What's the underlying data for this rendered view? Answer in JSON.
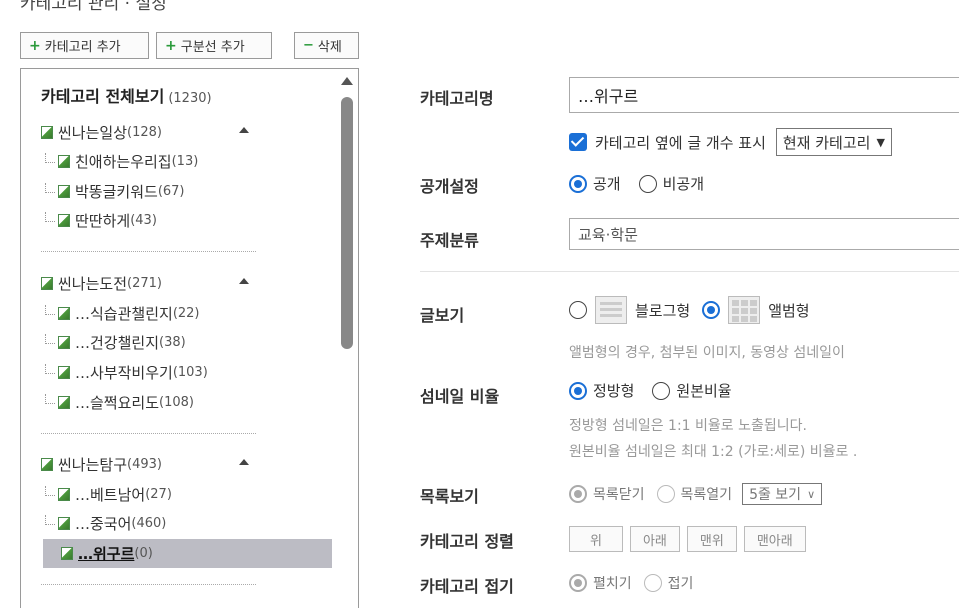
{
  "page": {
    "title": "카테고리 관리 · 설정"
  },
  "toolbar": {
    "add_category": "카테고리 추가",
    "add_separator": "구분선 추가",
    "delete": "삭제"
  },
  "tree": {
    "header": "카테고리 전체보기",
    "header_count": "(1230)",
    "groups": [
      {
        "label": "씬나는일상",
        "count": "(128)",
        "children": [
          {
            "label": "친애하는우리집",
            "count": "(13)"
          },
          {
            "label": "박똥글키워드",
            "count": "(67)"
          },
          {
            "label": "딴딴하게",
            "count": "(43)"
          }
        ]
      },
      {
        "label": "씬나는도전",
        "count": "(271)",
        "children": [
          {
            "label": "…식습관챌린지",
            "count": "(22)"
          },
          {
            "label": "…건강챌린지",
            "count": "(38)"
          },
          {
            "label": "…사부작비우기",
            "count": "(103)"
          },
          {
            "label": "…슬쩍요리도",
            "count": "(108)"
          }
        ]
      },
      {
        "label": "씬나는탐구",
        "count": "(493)",
        "children": [
          {
            "label": "…베트남어",
            "count": "(27)"
          },
          {
            "label": "…중국어",
            "count": "(460)"
          },
          {
            "label": "…위구르",
            "count": "(0)"
          }
        ]
      }
    ]
  },
  "form": {
    "name_label": "카테고리명",
    "name_value": "…위구르",
    "show_count_label": "카테고리 옆에 글 개수 표시",
    "show_count_select": "현재 카테고리",
    "visibility_label": "공개설정",
    "visibility_public": "공개",
    "visibility_private": "비공개",
    "topic_label": "주제분류",
    "topic_value": "교육·학문",
    "view_label": "글보기",
    "view_blog": "블로그형",
    "view_album": "앨범형",
    "view_hint": "앨범형의 경우, 첨부된 이미지, 동영상 섬네일이",
    "thumb_label": "섬네일 비율",
    "thumb_square": "정방형",
    "thumb_original": "원본비율",
    "thumb_hint1": "정방형 섬네일은 1:1 비율로 노출됩니다.",
    "thumb_hint2": "원본비율 섬네일은 최대 1:2 (가로:세로) 비율로 .",
    "list_label": "목록보기",
    "list_close": "목록닫기",
    "list_open": "목록열기",
    "list_rows_select": "5줄 보기",
    "sort_label": "카테고리 정렬",
    "sort_up": "위",
    "sort_down": "아래",
    "sort_top": "맨위",
    "sort_bottom": "맨아래",
    "fold_label": "카테고리 접기",
    "fold_expand": "펼치기",
    "fold_collapse": "접기"
  }
}
